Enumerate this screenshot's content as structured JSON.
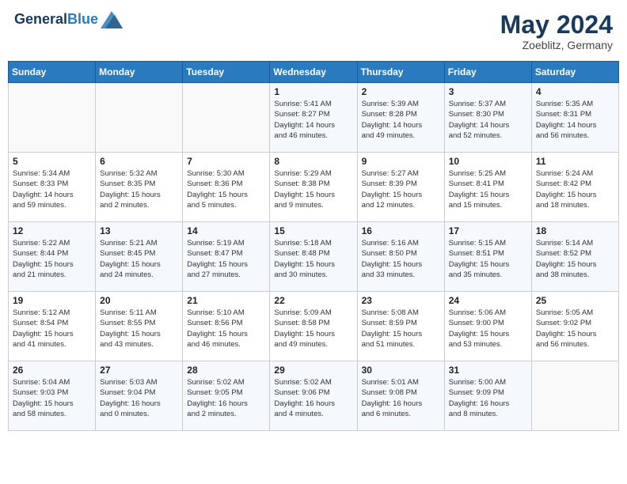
{
  "header": {
    "logo_line1": "General",
    "logo_line2": "Blue",
    "month": "May 2024",
    "location": "Zoeblitz, Germany"
  },
  "weekdays": [
    "Sunday",
    "Monday",
    "Tuesday",
    "Wednesday",
    "Thursday",
    "Friday",
    "Saturday"
  ],
  "weeks": [
    [
      {
        "day": "",
        "info": ""
      },
      {
        "day": "",
        "info": ""
      },
      {
        "day": "",
        "info": ""
      },
      {
        "day": "1",
        "info": "Sunrise: 5:41 AM\nSunset: 8:27 PM\nDaylight: 14 hours\nand 46 minutes."
      },
      {
        "day": "2",
        "info": "Sunrise: 5:39 AM\nSunset: 8:28 PM\nDaylight: 14 hours\nand 49 minutes."
      },
      {
        "day": "3",
        "info": "Sunrise: 5:37 AM\nSunset: 8:30 PM\nDaylight: 14 hours\nand 52 minutes."
      },
      {
        "day": "4",
        "info": "Sunrise: 5:35 AM\nSunset: 8:31 PM\nDaylight: 14 hours\nand 56 minutes."
      }
    ],
    [
      {
        "day": "5",
        "info": "Sunrise: 5:34 AM\nSunset: 8:33 PM\nDaylight: 14 hours\nand 59 minutes."
      },
      {
        "day": "6",
        "info": "Sunrise: 5:32 AM\nSunset: 8:35 PM\nDaylight: 15 hours\nand 2 minutes."
      },
      {
        "day": "7",
        "info": "Sunrise: 5:30 AM\nSunset: 8:36 PM\nDaylight: 15 hours\nand 5 minutes."
      },
      {
        "day": "8",
        "info": "Sunrise: 5:29 AM\nSunset: 8:38 PM\nDaylight: 15 hours\nand 9 minutes."
      },
      {
        "day": "9",
        "info": "Sunrise: 5:27 AM\nSunset: 8:39 PM\nDaylight: 15 hours\nand 12 minutes."
      },
      {
        "day": "10",
        "info": "Sunrise: 5:25 AM\nSunset: 8:41 PM\nDaylight: 15 hours\nand 15 minutes."
      },
      {
        "day": "11",
        "info": "Sunrise: 5:24 AM\nSunset: 8:42 PM\nDaylight: 15 hours\nand 18 minutes."
      }
    ],
    [
      {
        "day": "12",
        "info": "Sunrise: 5:22 AM\nSunset: 8:44 PM\nDaylight: 15 hours\nand 21 minutes."
      },
      {
        "day": "13",
        "info": "Sunrise: 5:21 AM\nSunset: 8:45 PM\nDaylight: 15 hours\nand 24 minutes."
      },
      {
        "day": "14",
        "info": "Sunrise: 5:19 AM\nSunset: 8:47 PM\nDaylight: 15 hours\nand 27 minutes."
      },
      {
        "day": "15",
        "info": "Sunrise: 5:18 AM\nSunset: 8:48 PM\nDaylight: 15 hours\nand 30 minutes."
      },
      {
        "day": "16",
        "info": "Sunrise: 5:16 AM\nSunset: 8:50 PM\nDaylight: 15 hours\nand 33 minutes."
      },
      {
        "day": "17",
        "info": "Sunrise: 5:15 AM\nSunset: 8:51 PM\nDaylight: 15 hours\nand 35 minutes."
      },
      {
        "day": "18",
        "info": "Sunrise: 5:14 AM\nSunset: 8:52 PM\nDaylight: 15 hours\nand 38 minutes."
      }
    ],
    [
      {
        "day": "19",
        "info": "Sunrise: 5:12 AM\nSunset: 8:54 PM\nDaylight: 15 hours\nand 41 minutes."
      },
      {
        "day": "20",
        "info": "Sunrise: 5:11 AM\nSunset: 8:55 PM\nDaylight: 15 hours\nand 43 minutes."
      },
      {
        "day": "21",
        "info": "Sunrise: 5:10 AM\nSunset: 8:56 PM\nDaylight: 15 hours\nand 46 minutes."
      },
      {
        "day": "22",
        "info": "Sunrise: 5:09 AM\nSunset: 8:58 PM\nDaylight: 15 hours\nand 49 minutes."
      },
      {
        "day": "23",
        "info": "Sunrise: 5:08 AM\nSunset: 8:59 PM\nDaylight: 15 hours\nand 51 minutes."
      },
      {
        "day": "24",
        "info": "Sunrise: 5:06 AM\nSunset: 9:00 PM\nDaylight: 15 hours\nand 53 minutes."
      },
      {
        "day": "25",
        "info": "Sunrise: 5:05 AM\nSunset: 9:02 PM\nDaylight: 15 hours\nand 56 minutes."
      }
    ],
    [
      {
        "day": "26",
        "info": "Sunrise: 5:04 AM\nSunset: 9:03 PM\nDaylight: 15 hours\nand 58 minutes."
      },
      {
        "day": "27",
        "info": "Sunrise: 5:03 AM\nSunset: 9:04 PM\nDaylight: 16 hours\nand 0 minutes."
      },
      {
        "day": "28",
        "info": "Sunrise: 5:02 AM\nSunset: 9:05 PM\nDaylight: 16 hours\nand 2 minutes."
      },
      {
        "day": "29",
        "info": "Sunrise: 5:02 AM\nSunset: 9:06 PM\nDaylight: 16 hours\nand 4 minutes."
      },
      {
        "day": "30",
        "info": "Sunrise: 5:01 AM\nSunset: 9:08 PM\nDaylight: 16 hours\nand 6 minutes."
      },
      {
        "day": "31",
        "info": "Sunrise: 5:00 AM\nSunset: 9:09 PM\nDaylight: 16 hours\nand 8 minutes."
      },
      {
        "day": "",
        "info": ""
      }
    ]
  ]
}
